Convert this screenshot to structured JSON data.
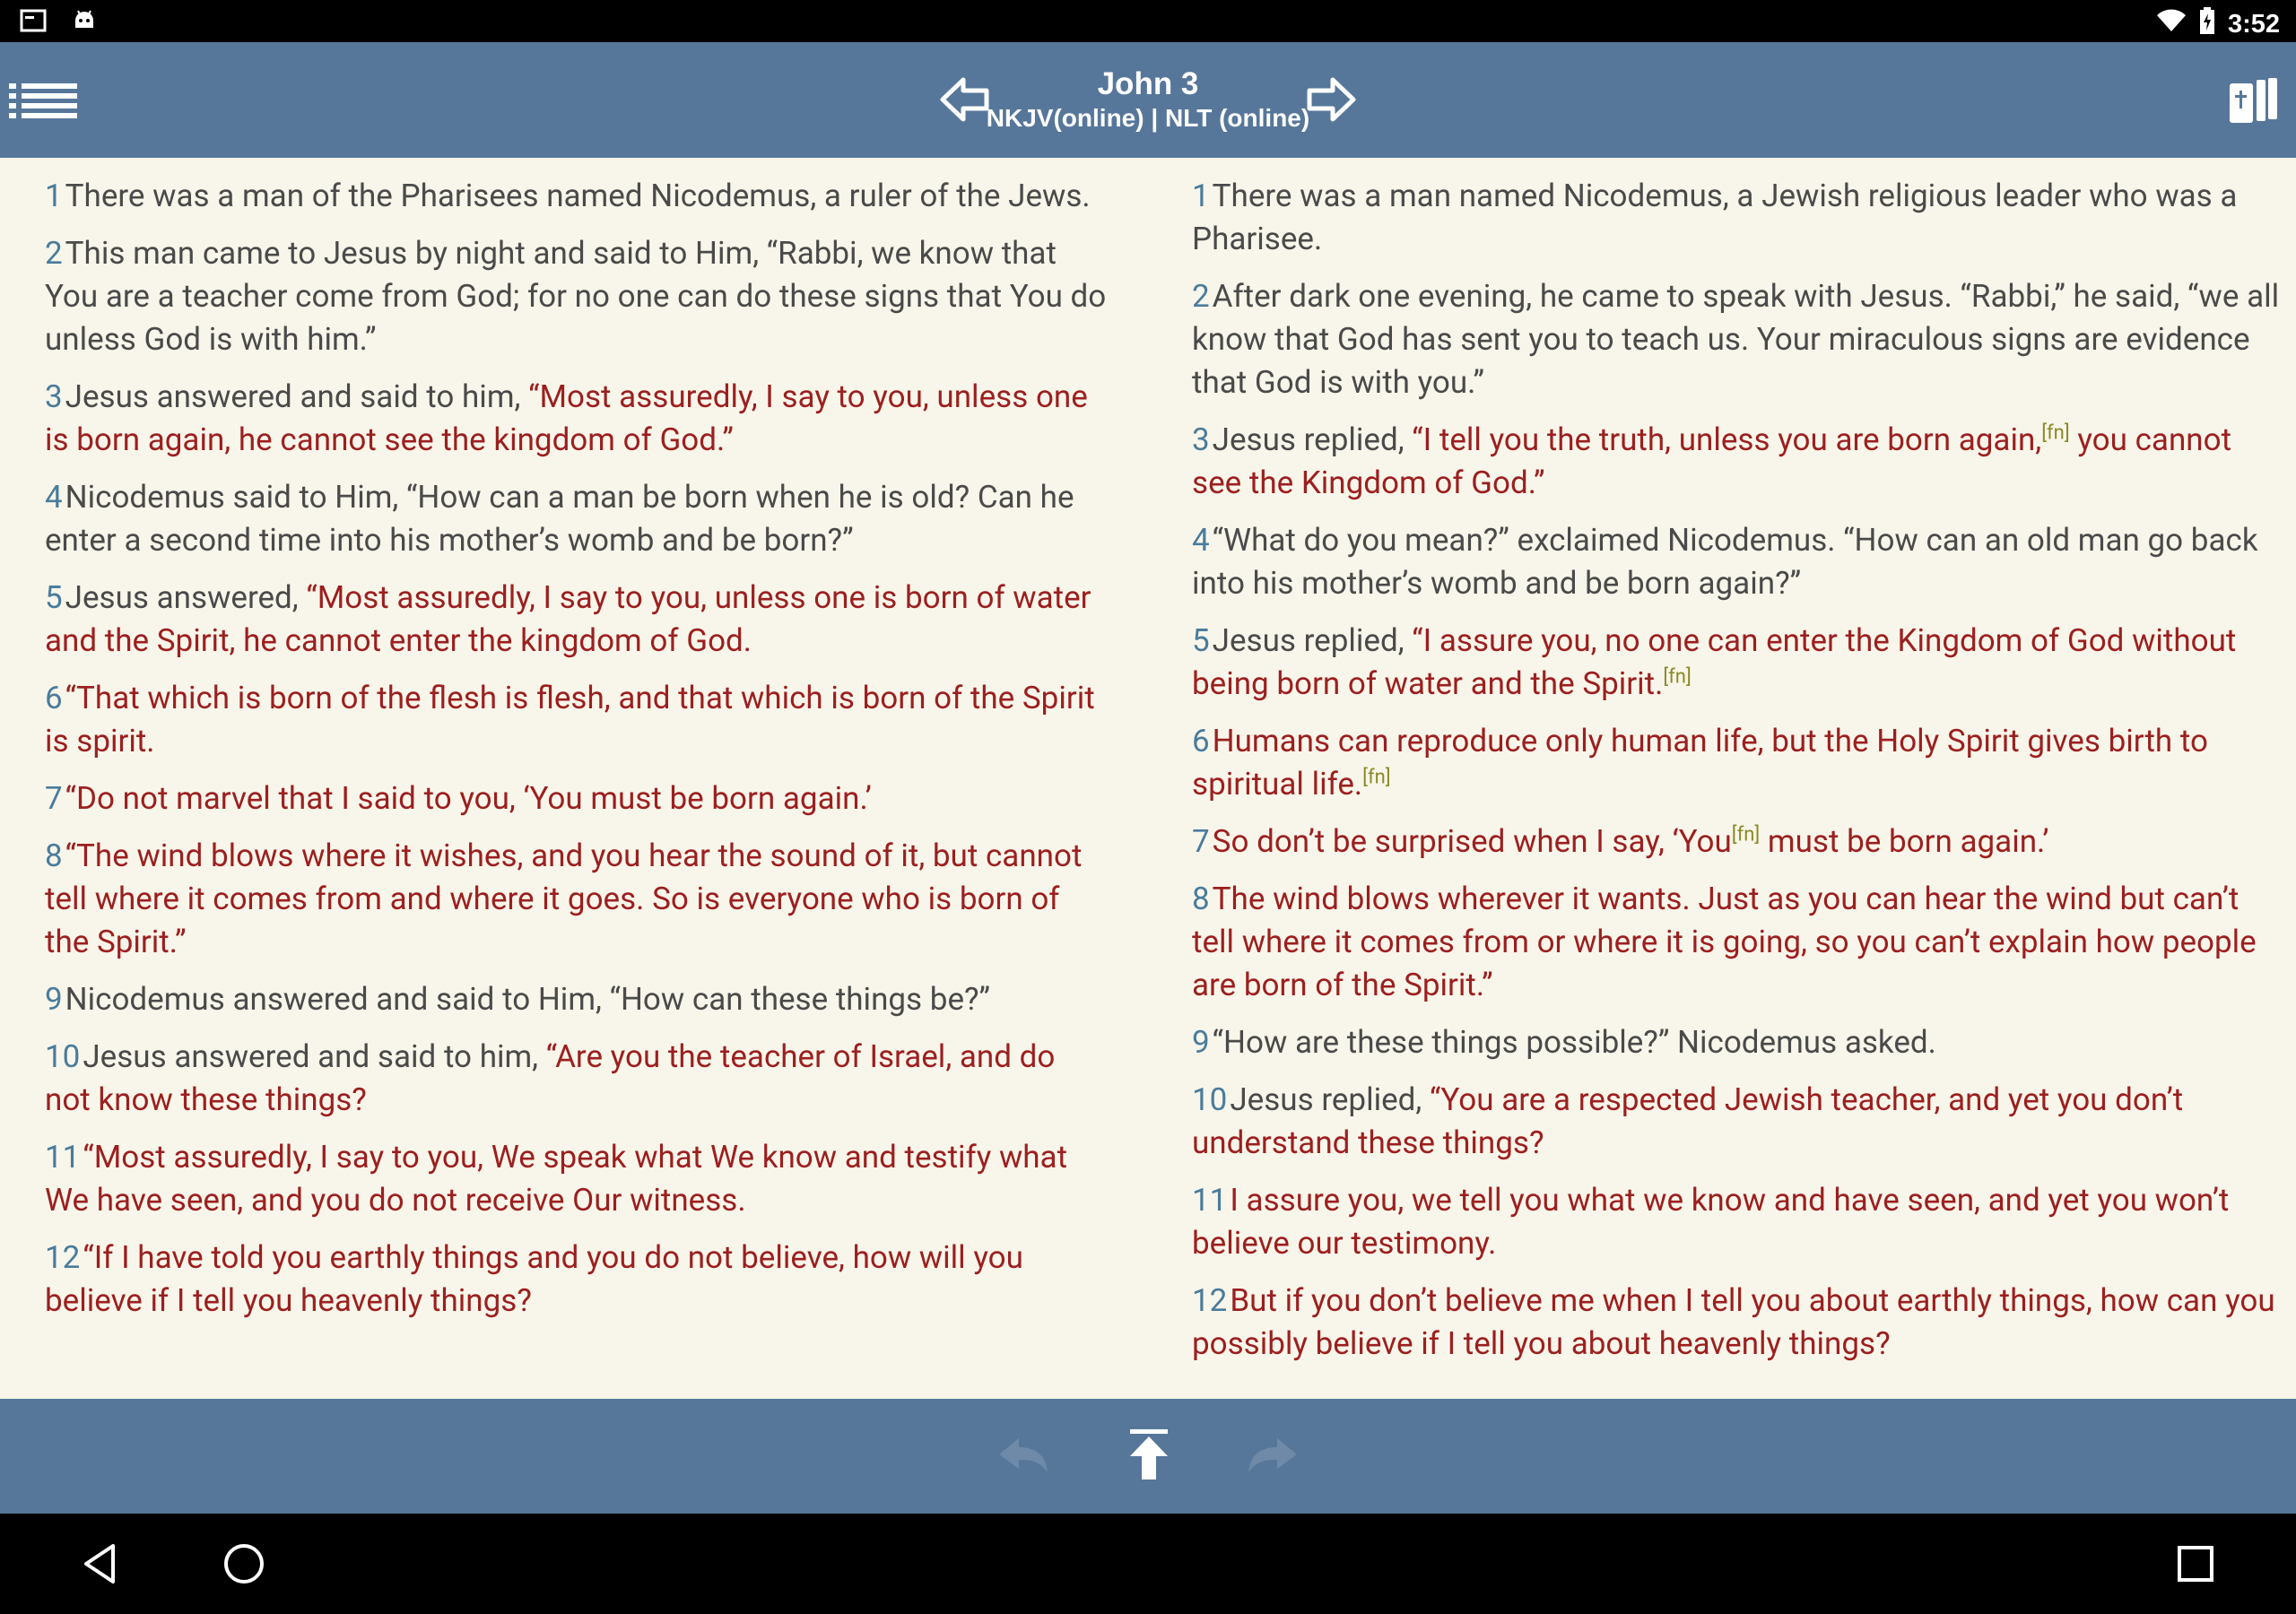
{
  "status_bar": {
    "time": "3:52",
    "left_icons": [
      "screenshot-icon",
      "android-icon"
    ],
    "right_icons": [
      "wifi-icon",
      "battery-charging-icon"
    ]
  },
  "header": {
    "title": "John 3",
    "subtitle": "NKJV(online) | NLT (online)",
    "icons": [
      "menu-list-icon",
      "arrow-left-icon",
      "arrow-right-icon",
      "bible-books-icon"
    ]
  },
  "left_column": {
    "verses": [
      {
        "num": "1",
        "parts": [
          {
            "t": "There was a man of the Pharisees named Nicodemus, a ruler of the Jews."
          }
        ]
      },
      {
        "num": "2",
        "parts": [
          {
            "t": "This man came to Jesus by night and said to Him, “Rabbi, we know that You are a teacher come from God; for no one can do these signs that You do unless God is with him.”"
          }
        ]
      },
      {
        "num": "3",
        "parts": [
          {
            "t": "Jesus answered and said to him, "
          },
          {
            "t": "“Most assuredly, I say to you, unless one is born again, he cannot see the kingdom of God.”",
            "red": true
          }
        ]
      },
      {
        "num": "4",
        "parts": [
          {
            "t": "Nicodemus said to Him, “How can a man be born when he is old? Can he enter a second time into his mother’s womb and be born?”"
          }
        ]
      },
      {
        "num": "5",
        "parts": [
          {
            "t": "Jesus answered, "
          },
          {
            "t": "“Most assuredly, I say to you, unless one is born of water and the Spirit, he cannot enter the kingdom of God.",
            "red": true
          }
        ]
      },
      {
        "num": "6",
        "parts": [
          {
            "t": "“That which is born of the flesh is flesh, and that which is born of the Spirit is spirit.",
            "red": true
          }
        ]
      },
      {
        "num": "7",
        "parts": [
          {
            "t": "“Do not marvel that I said to you, ‘You must be born again.’",
            "red": true
          }
        ]
      },
      {
        "num": "8",
        "parts": [
          {
            "t": "“The wind blows where it wishes, and you hear the sound of it, but cannot tell where it comes from and where it goes. So is everyone who is born of the Spirit.”",
            "red": true
          }
        ]
      },
      {
        "num": "9",
        "parts": [
          {
            "t": "Nicodemus answered and said to Him, “How can these things be?”"
          }
        ]
      },
      {
        "num": "10",
        "parts": [
          {
            "t": "Jesus answered and said to him, "
          },
          {
            "t": "“Are you the teacher of Israel, and do not know these things?",
            "red": true
          }
        ]
      },
      {
        "num": "11",
        "parts": [
          {
            "t": "“Most assuredly, I say to you, We speak what We know and testify what We have seen, and you do not receive Our witness.",
            "red": true
          }
        ]
      },
      {
        "num": "12",
        "parts": [
          {
            "t": "“If I have told you earthly things and you do not believe, how will you believe if I tell you heavenly things?",
            "red": true
          }
        ]
      }
    ]
  },
  "right_column": {
    "verses": [
      {
        "num": "1",
        "parts": [
          {
            "t": "There was a man named Nicodemus, a Jewish religious leader who was a Pharisee."
          }
        ]
      },
      {
        "num": "2",
        "parts": [
          {
            "t": "After dark one evening, he came to speak with Jesus. “Rabbi,” he said, “we all know that God has sent you to teach us. Your miraculous signs are evidence that God is with you.”"
          }
        ]
      },
      {
        "num": "3",
        "parts": [
          {
            "t": "Jesus replied, "
          },
          {
            "t": "“I tell you the truth, unless you are born again,",
            "red": true
          },
          {
            "fn": "[fn]"
          },
          {
            "t": " you cannot see the Kingdom of God.”",
            "red": true
          }
        ]
      },
      {
        "num": "4",
        "parts": [
          {
            "t": "“What do you mean?” exclaimed Nicodemus. “How can an old man go back into his mother’s womb and be born again?”"
          }
        ]
      },
      {
        "num": "5",
        "parts": [
          {
            "t": "Jesus replied, "
          },
          {
            "t": "“I assure you, no one can enter the Kingdom of God without being born of water and the Spirit.",
            "red": true
          },
          {
            "fn": "[fn]"
          }
        ]
      },
      {
        "num": "6",
        "parts": [
          {
            "t": "Humans can reproduce only human life, but the Holy Spirit gives birth to spiritual life.",
            "red": true
          },
          {
            "fn": "[fn]"
          }
        ]
      },
      {
        "num": "7",
        "parts": [
          {
            "t": "So don’t be surprised when I say, ‘You",
            "red": true
          },
          {
            "fn": "[fn]"
          },
          {
            "t": " must be born again.’",
            "red": true
          }
        ]
      },
      {
        "num": "8",
        "parts": [
          {
            "t": "The wind blows wherever it wants. Just as you can hear the wind but can’t tell where it comes from or where it is going, so you can’t explain how people are born of the Spirit.”",
            "red": true
          }
        ]
      },
      {
        "num": "9",
        "parts": [
          {
            "t": "“How are these things possible?” Nicodemus asked."
          }
        ]
      },
      {
        "num": "10",
        "parts": [
          {
            "t": "Jesus replied, "
          },
          {
            "t": "“You are a respected Jewish teacher, and yet you don’t understand these things?",
            "red": true
          }
        ]
      },
      {
        "num": "11",
        "parts": [
          {
            "t": "I assure you, we tell you what we know and have seen, and yet you won’t believe our testimony.",
            "red": true
          }
        ]
      },
      {
        "num": "12",
        "parts": [
          {
            "t": "But if you don’t believe me when I tell you about earthly things, how can you possibly believe if I tell you about heavenly things?",
            "red": true
          }
        ]
      }
    ]
  },
  "bottom_bar": {
    "icons": [
      "history-back-icon",
      "scroll-to-top-icon",
      "history-forward-icon"
    ]
  },
  "nav_bar": {
    "icons": [
      "nav-back-icon",
      "nav-home-icon",
      "nav-recents-icon"
    ]
  }
}
